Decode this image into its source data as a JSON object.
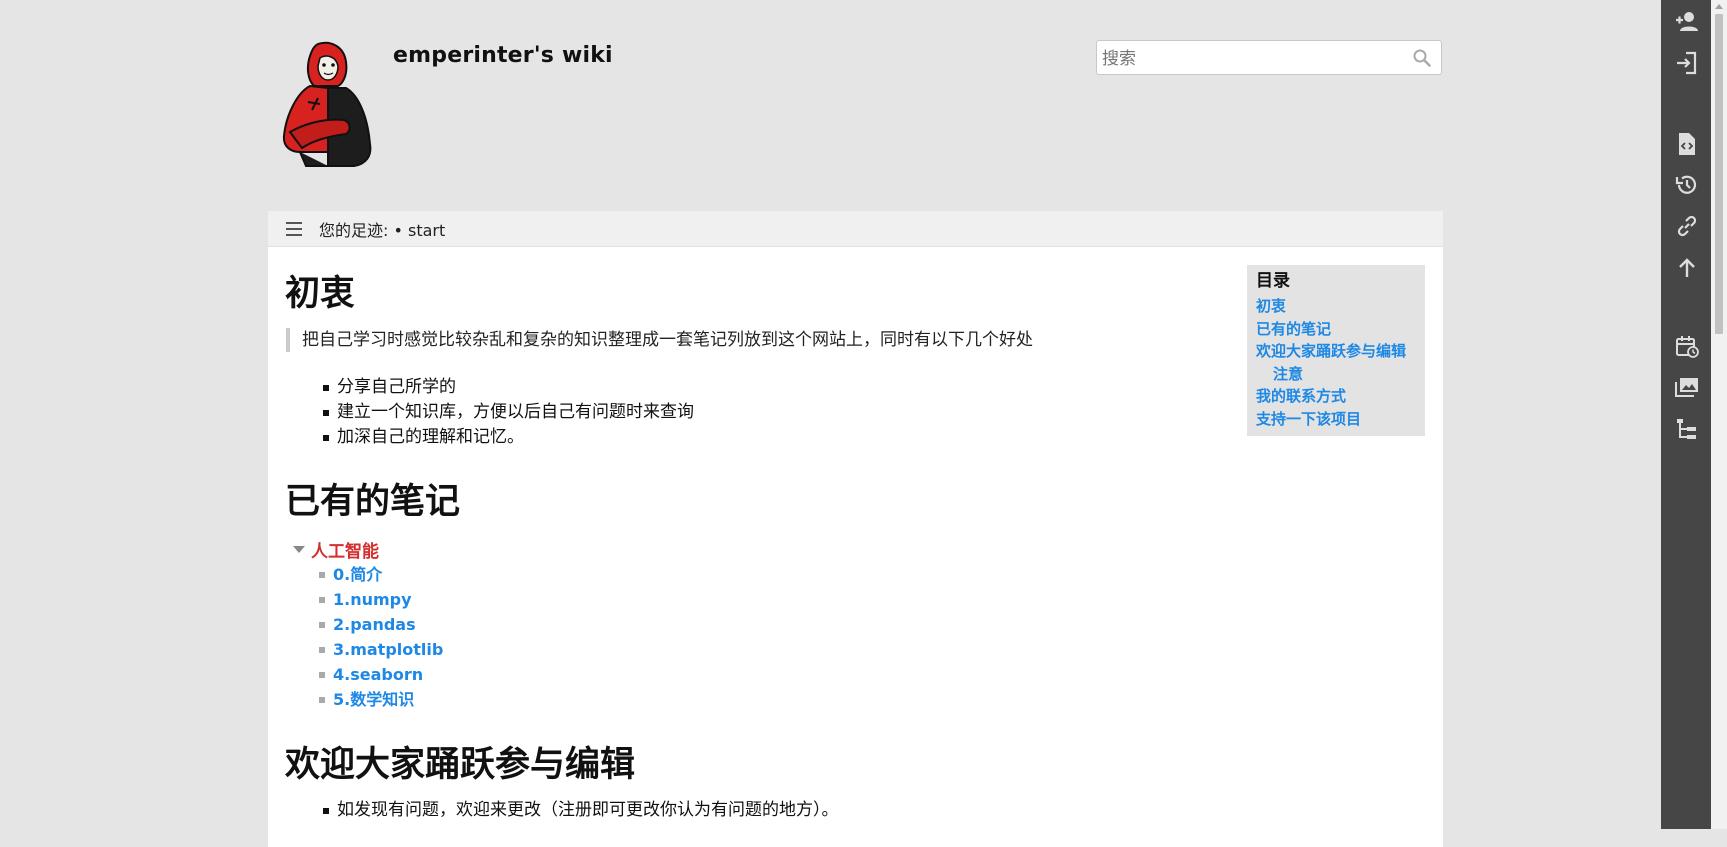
{
  "site": {
    "title": "emperinter's wiki",
    "logo_icon": "hooded-mask-figure-logo"
  },
  "search": {
    "placeholder": "搜索",
    "icon": "search-icon"
  },
  "breadcrumbs": {
    "text": "您的足迹: • start"
  },
  "content": {
    "h1_intro": "初衷",
    "intro_quote": "把自己学习时感觉比较杂乱和复杂的知识整理成一套笔记列放到这个网站上，同时有以下几个好处",
    "benefits": [
      "分享自己所学的",
      "建立一个知识库，方便以后自己有问题时来查询",
      "加深自己的理解和记忆。"
    ],
    "h1_notes": "已有的笔记",
    "notes_tree": {
      "category": "人工智能",
      "items": [
        "0.简介",
        "1.numpy",
        "2.pandas",
        "3.matplotlib",
        "4.seaborn",
        "5.数学知识"
      ]
    },
    "h1_edit": "欢迎大家踊跃参与编辑",
    "edit_items": [
      "如发现有问题，欢迎来更改（注册即可更改你认为有问题的地方）。"
    ]
  },
  "toc": {
    "title": "目录",
    "items": [
      {
        "label": "初衷",
        "level": 1
      },
      {
        "label": "已有的笔记",
        "level": 1
      },
      {
        "label": "欢迎大家踊跃参与编辑",
        "level": 1
      },
      {
        "label": "注意",
        "level": 2
      },
      {
        "label": "我的联系方式",
        "level": 1
      },
      {
        "label": "支持一下该项目",
        "level": 1
      }
    ]
  },
  "colors": {
    "link": "#1e88e5",
    "category_red": "#d32f2f",
    "page_bg": "#e5e5e5",
    "sidebar_bg": "#464646"
  },
  "sidebar_tools": [
    "register-icon",
    "login-icon",
    "show-source-icon",
    "history-icon",
    "backlinks-icon",
    "back-to-top-icon",
    "recent-changes-icon",
    "media-manager-icon",
    "sitemap-icon"
  ]
}
